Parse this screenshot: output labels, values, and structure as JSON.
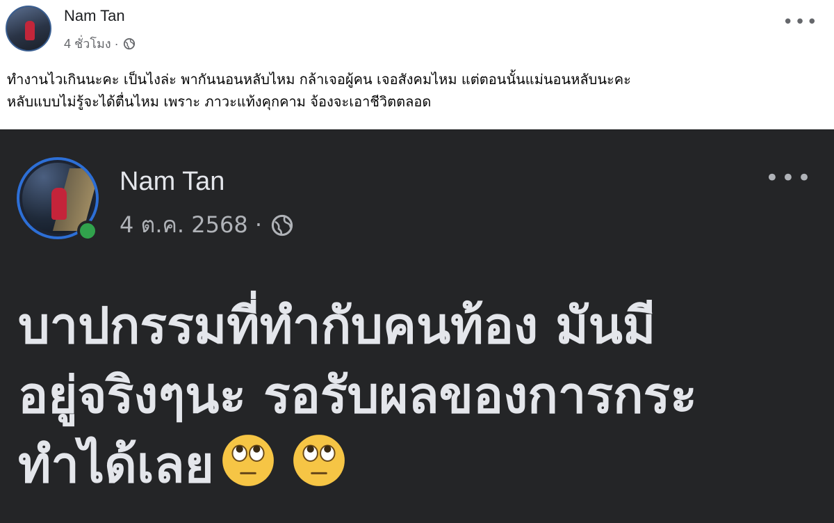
{
  "post": {
    "author": "Nam Tan",
    "time": "4 ชั่วโมง ·",
    "caption_line1": "ทำงานไวเกินนะคะ  เป็นไงล่ะ พากันนอนหลับไหม กล้าเจอผู้คน เจอสังคมไหม แต่ตอนนั้นแม่นอนหลับนะคะ",
    "caption_line2": "หลับแบบไม่รู้จะได้ตื่นไหม เพราะ ภาวะแท้งคุกคาม จ้องจะเอาชีวิตตลอด",
    "more": "•••"
  },
  "embedded": {
    "author": "Nam Tan",
    "date": "4 ต.ค. 2568 ·",
    "more": "•••",
    "line1": "บาปกรรมที่ทำกับคนท้อง มันมี",
    "line2": "อยู่จริงๆนะ รอรับผลของการกระ",
    "line3": "ทำได้เลย",
    "status_color": "#31a24c",
    "ring_color": "#2d6fd6"
  },
  "icons": [
    "globe-icon",
    "more-options-icon",
    "eye-roll-emoji"
  ]
}
